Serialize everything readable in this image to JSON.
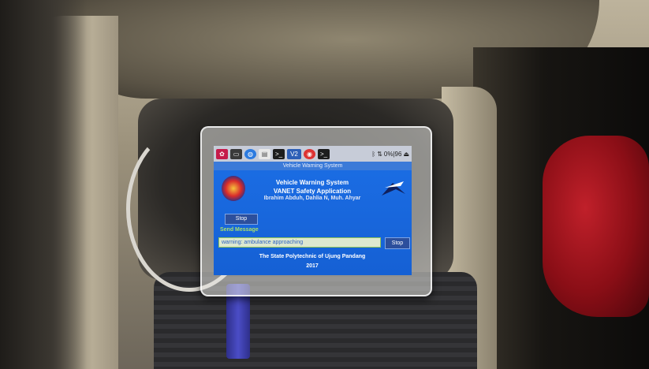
{
  "taskbar": {
    "icons": [
      "raspberry-icon",
      "terminal-icon",
      "globe-icon",
      "folder-icon",
      "terminal-icon",
      "vnc-icon",
      "chrome-icon",
      "terminal-icon"
    ],
    "vnc_label": "V2",
    "status_text": "0%|96"
  },
  "window": {
    "title": "Vehicle Warning System"
  },
  "header": {
    "line1": "Vehicle Warning System",
    "line2": "VANET Safety Application",
    "authors": "Ibrahim Abduh, Dahlia N, Muh. Ahyar"
  },
  "controls": {
    "stop_top_label": "Stop",
    "send_label": "Send Message",
    "message_value": "warning: ambulance approaching",
    "stop_send_label": "Stop"
  },
  "footer": {
    "institution": "The State Polytechnic of Ujung Pandang",
    "year": "2017"
  },
  "colors": {
    "screen_bg": "#1560d4",
    "send_label": "#a8e06a",
    "input_text": "#2e63c4"
  }
}
